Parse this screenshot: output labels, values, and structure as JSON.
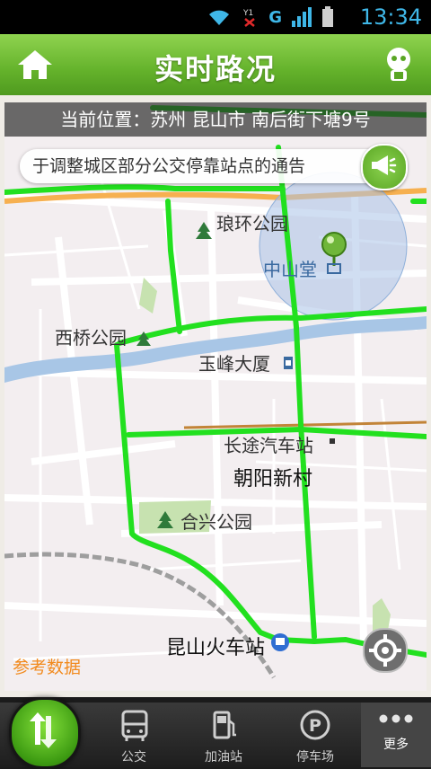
{
  "status_bar": {
    "time": "13:34",
    "carrier_badge": "G",
    "icons": [
      "wifi-icon",
      "no-signal-icon",
      "signal-icon",
      "battery-icon"
    ]
  },
  "header": {
    "title": "实时路况",
    "icons": [
      "home-icon",
      "user-icon"
    ]
  },
  "location_bar": {
    "text": "当前位置：苏州 昆山市 南后街下塘9号"
  },
  "notice": {
    "text": "于调整城区部分公交停靠站点的通告",
    "icon": "megaphone-icon"
  },
  "map": {
    "labels": {
      "langhuan_park": "琅环公园",
      "zhongshan_hall": "中山堂",
      "xiqiao_park": "西桥公园",
      "yufeng_tower": "玉峰大厦",
      "bus_station": "长途汽车站",
      "chaoyang": "朝阳新村",
      "hexing_park": "合兴公园",
      "train_station": "昆山火车站"
    },
    "reference_text": "参考数据",
    "colors": {
      "traffic_clear": "#22e01f",
      "river": "#a8c6e6",
      "location_circle": "#a9c3e8",
      "road": "#ffffff",
      "park": "#c7e2b0"
    }
  },
  "bottom_bar": {
    "tabs": [
      {
        "label": "公交",
        "icon": "bus-icon"
      },
      {
        "label": "加油站",
        "icon": "fuel-pump-icon"
      },
      {
        "label": "停车场",
        "icon": "parking-icon"
      }
    ],
    "more_label": "更多",
    "icons": [
      "traffic-arrows-icon",
      "more-dots-icon"
    ]
  }
}
